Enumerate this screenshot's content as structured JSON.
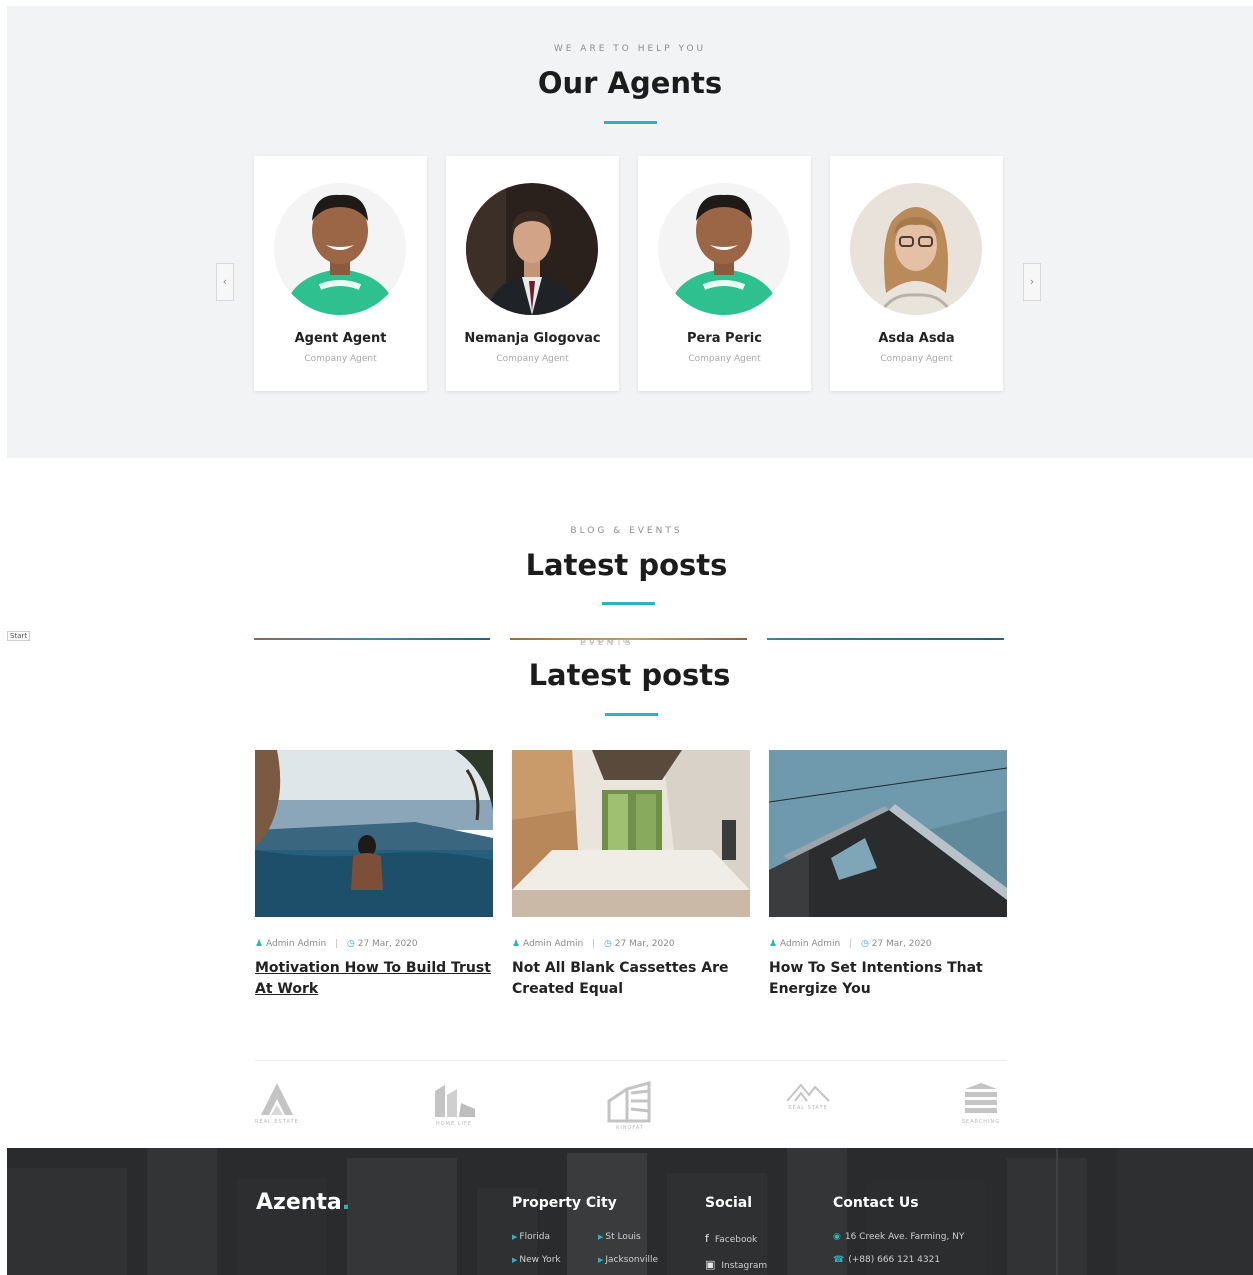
{
  "agents_section": {
    "eyebrow": "WE ARE TO HELP YOU",
    "title": "Our Agents",
    "prev_icon": "‹",
    "next_icon": "›",
    "agents": [
      {
        "name": "Agent Agent",
        "role": "Company Agent"
      },
      {
        "name": "Nemanja Glogovac",
        "role": "Company Agent"
      },
      {
        "name": "Pera Peric",
        "role": "Company Agent"
      },
      {
        "name": "Asda Asda",
        "role": "Company Agent"
      }
    ]
  },
  "posts_section": {
    "eyebrow": "BLOG & EVENTS",
    "title": "Latest posts",
    "start_label": "Start",
    "title_repeat": "Latest posts",
    "posts": [
      {
        "author": "Admin Admin",
        "date": "27 Mar, 2020",
        "title": "Motivation How To Build Trust At Work"
      },
      {
        "author": "Admin Admin",
        "date": "27 Mar, 2020",
        "title": "Not All Blank Cassettes Are Created Equal"
      },
      {
        "author": "Admin Admin",
        "date": "27 Mar, 2020",
        "title": "How To Set Intentions That Energize You"
      }
    ]
  },
  "partners": [
    "REAL ESTATE",
    "HOME LIFE",
    "KINGFAT",
    "REAL STATE",
    "SEARCHING"
  ],
  "footer": {
    "brand": "Azenta",
    "brand_dot": ".",
    "property_city": {
      "heading": "Property City",
      "links": [
        "Florida",
        "St Louis",
        "New York",
        "Jacksonville"
      ]
    },
    "social": {
      "heading": "Social",
      "links": [
        "Facebook",
        "Instagram"
      ]
    },
    "contact": {
      "heading": "Contact Us",
      "address": "16 Creek Ave. Farming, NY",
      "phone": "(+88) 666 121 4321"
    }
  },
  "colors": {
    "accent": "#2bb3c0",
    "section_bg": "#f2f3f4",
    "footer_bg": "#242526"
  }
}
